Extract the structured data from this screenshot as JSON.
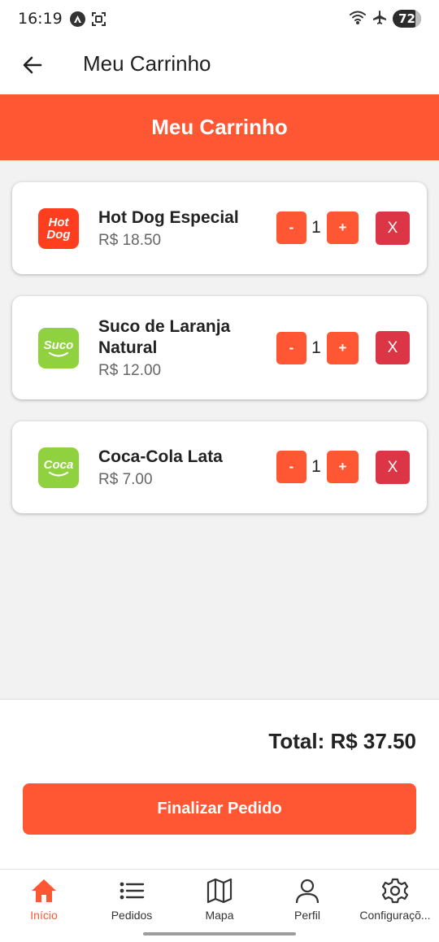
{
  "status_bar": {
    "time": "16:19",
    "battery": "72"
  },
  "app_bar": {
    "title": "Meu Carrinho"
  },
  "banner": {
    "title": "Meu Carrinho"
  },
  "cart": {
    "items": [
      {
        "name": "Hot Dog Especial",
        "price": "R$ 18.50",
        "quantity": "1",
        "logo_text_1": "Hot",
        "logo_text_2": "Dog",
        "logo_color": "#ff3d1f",
        "minus": "-",
        "plus": "+",
        "remove": "X"
      },
      {
        "name": "Suco de Laranja Natural",
        "price": "R$ 12.00",
        "quantity": "1",
        "logo_text_1": "Suco",
        "logo_text_2": "",
        "logo_color": "#8fd13f",
        "minus": "-",
        "plus": "+",
        "remove": "X"
      },
      {
        "name": "Coca-Cola Lata",
        "price": "R$ 7.00",
        "quantity": "1",
        "logo_text_1": "Coca",
        "logo_text_2": "",
        "logo_color": "#8fd13f",
        "minus": "-",
        "plus": "+",
        "remove": "X"
      }
    ]
  },
  "summary": {
    "total": "Total: R$ 37.50",
    "checkout_label": "Finalizar Pedido"
  },
  "bottom_nav": {
    "items": [
      {
        "label": "Início",
        "icon": "home-icon",
        "active": true
      },
      {
        "label": "Pedidos",
        "icon": "list-icon",
        "active": false
      },
      {
        "label": "Mapa",
        "icon": "map-icon",
        "active": false
      },
      {
        "label": "Perfil",
        "icon": "person-icon",
        "active": false
      },
      {
        "label": "Configuraçõ...",
        "icon": "gear-icon",
        "active": false
      }
    ]
  },
  "colors": {
    "accent": "#ff5733",
    "danger": "#dc3545",
    "background": "#f2f2f2"
  }
}
